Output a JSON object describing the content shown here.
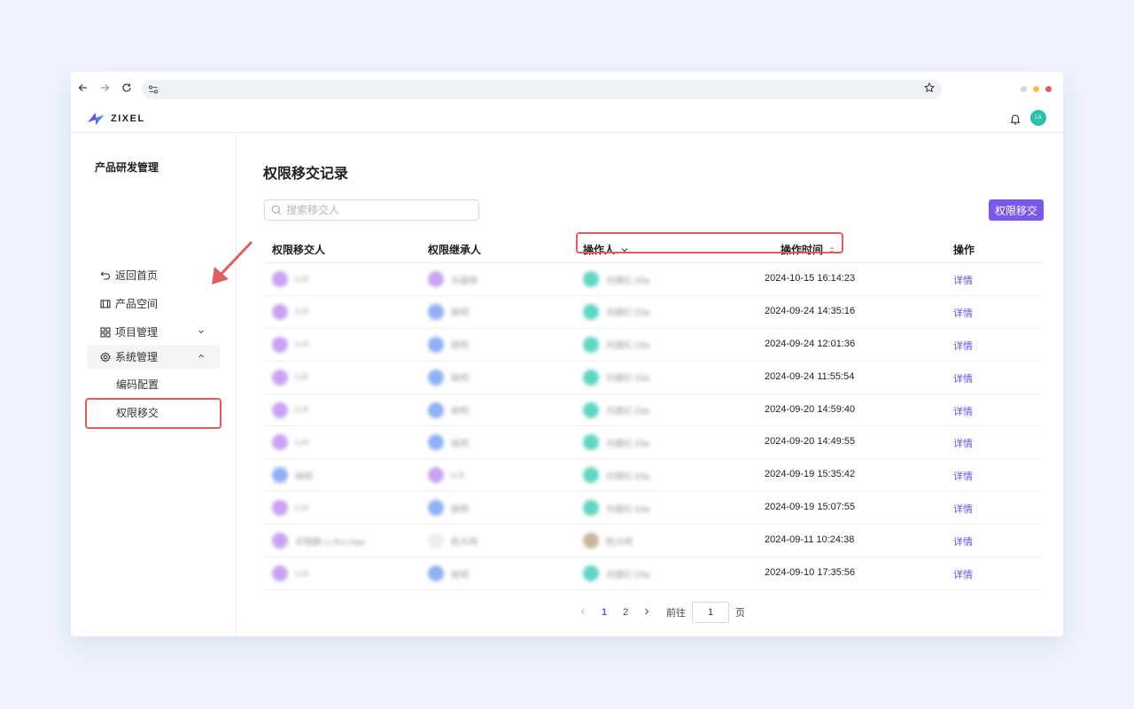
{
  "app": {
    "logo_text": "ZIXEL",
    "user_initials": "LA"
  },
  "sidebar": {
    "title": "产品研发管理",
    "items": [
      {
        "label": "返回首页"
      },
      {
        "label": "产品空间"
      },
      {
        "label": "项目管理"
      },
      {
        "label": "系统管理"
      }
    ],
    "subitems": [
      {
        "label": "编码配置"
      },
      {
        "label": "权限移交"
      }
    ]
  },
  "main": {
    "title": "权限移交记录",
    "search_placeholder": "搜索移交人",
    "primary_button": "权限移交",
    "columns": {
      "from": "权限移交人",
      "to": "权限继承人",
      "operator": "操作人",
      "time": "操作时间",
      "action": "操作"
    },
    "rows": [
      {
        "from": "LiJi",
        "to": "马蕴琪",
        "operator": "刘建红 Ella",
        "time": "2024-10-15 16:14:23",
        "action": "详情"
      },
      {
        "from": "LiJi",
        "to": "姚明",
        "operator": "刘建红 Ella",
        "time": "2024-09-24 14:35:16",
        "action": "详情"
      },
      {
        "from": "LiJi",
        "to": "姚明",
        "operator": "刘建红 Ella",
        "time": "2024-09-24 12:01:36",
        "action": "详情"
      },
      {
        "from": "LiJi",
        "to": "姚明",
        "operator": "刘建红 Ella",
        "time": "2024-09-24 11:55:54",
        "action": "详情"
      },
      {
        "from": "LiJi",
        "to": "姚明",
        "operator": "刘建红 Ella",
        "time": "2024-09-20 14:59:40",
        "action": "详情"
      },
      {
        "from": "LiJi",
        "to": "姚明",
        "operator": "刘建红 Ella",
        "time": "2024-09-20 14:49:55",
        "action": "详情"
      },
      {
        "from": "姚明",
        "to": "LiJi",
        "operator": "刘建红 Ella",
        "time": "2024-09-19 15:35:42",
        "action": "详情"
      },
      {
        "from": "LiJi",
        "to": "姚明",
        "operator": "刘建红 Ella",
        "time": "2024-09-19 15:07:55",
        "action": "详情"
      },
      {
        "from": "邓锦鹏 Li Rui Han",
        "to": "陈大明",
        "operator": "陈大明",
        "time": "2024-09-11 10:24:38",
        "action": "详情"
      },
      {
        "from": "LiJi",
        "to": "姚明",
        "operator": "刘建红 Ella",
        "time": "2024-09-10 17:35:56",
        "action": "详情"
      }
    ],
    "pagination": {
      "pages": [
        "1",
        "2"
      ],
      "current": "1",
      "goto_label": "前往",
      "goto_value": "1",
      "page_suffix": "页"
    }
  },
  "colors": {
    "accent": "#7b57f0",
    "highlight": "#e25c5c",
    "avatar_purple": "#c9a3f2",
    "avatar_blue": "#8fb0f5",
    "avatar_teal": "#5fd6c4"
  }
}
